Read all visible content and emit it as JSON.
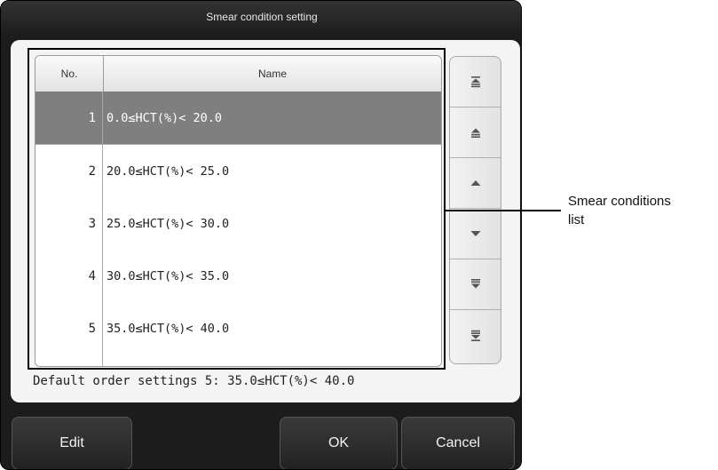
{
  "dialog": {
    "title": "Smear condition setting"
  },
  "table": {
    "headers": {
      "no": "No.",
      "name": "Name"
    },
    "rows": [
      {
        "no": "1",
        "name": " 0.0≤HCT(%)< 20.0",
        "selected": true
      },
      {
        "no": "2",
        "name": "20.0≤HCT(%)< 25.0",
        "selected": false
      },
      {
        "no": "3",
        "name": "25.0≤HCT(%)< 30.0",
        "selected": false
      },
      {
        "no": "4",
        "name": "30.0≤HCT(%)< 35.0",
        "selected": false
      },
      {
        "no": "5",
        "name": "35.0≤HCT(%)< 40.0",
        "selected": false
      }
    ]
  },
  "scroll_buttons": [
    "scroll-top-icon",
    "page-up-icon",
    "line-up-icon",
    "line-down-icon",
    "page-down-icon",
    "scroll-bottom-icon"
  ],
  "status": {
    "default_order": "Default order settings 5: 35.0≤HCT(%)< 40.0"
  },
  "buttons": {
    "edit": "Edit",
    "ok": "OK",
    "cancel": "Cancel"
  },
  "callout": {
    "line1": "Smear conditions",
    "line2": "list"
  },
  "colors": {
    "selected_row": "#7f7f7f",
    "dialog_bg": "#1c1c1c",
    "panel_bg": "#f4f4f4"
  }
}
